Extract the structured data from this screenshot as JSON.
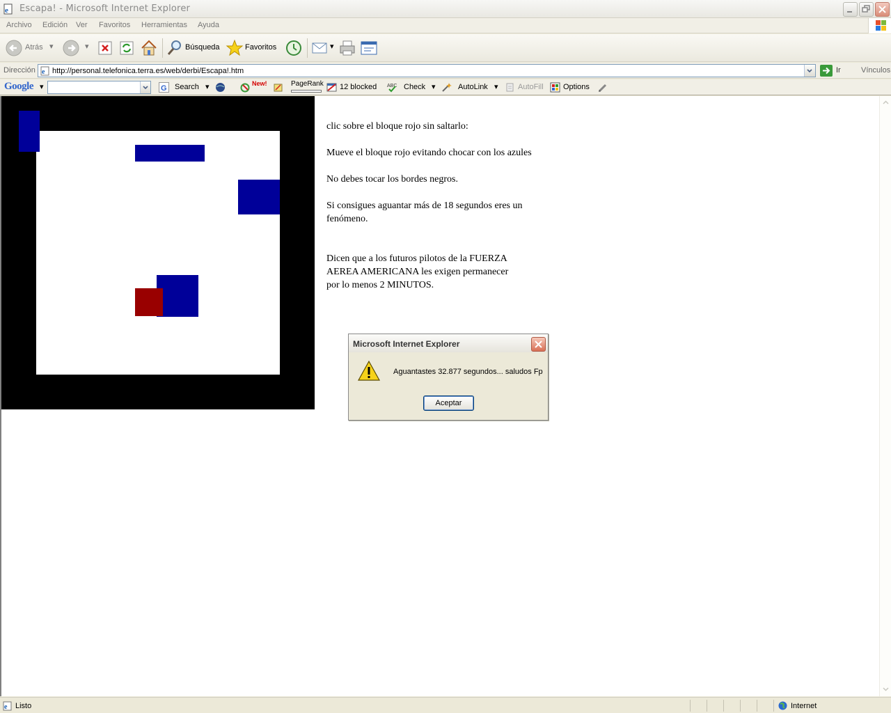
{
  "window": {
    "title": "Escapa! - Microsoft Internet Explorer"
  },
  "menu": {
    "items": [
      "Archivo",
      "Edición",
      "Ver",
      "Favoritos",
      "Herramientas",
      "Ayuda"
    ]
  },
  "toolbar": {
    "back_label": "Atrás",
    "search_label": "Búsqueda",
    "favorites_label": "Favoritos"
  },
  "address": {
    "label": "Dirección",
    "url": "http://personal.telefonica.terra.es/web/derbi/Escapa!.htm",
    "go_label": "Ir",
    "links_label": "Vínculos"
  },
  "google_toolbar": {
    "logo": "Google",
    "search_label": "Search",
    "new_badge": "New!",
    "pagerank_label": "PageRank",
    "blocked_label": "12 blocked",
    "check_label": "Check",
    "autolink_label": "AutoLink",
    "autofill_label": "AutoFill",
    "options_label": "Options"
  },
  "page": {
    "instructions": [
      "clic sobre el bloque rojo sin saltarlo:",
      "Mueve el bloque rojo evitando chocar con los azules",
      "No debes tocar los bordes negros.",
      "Si consigues aguantar más de 18 segundos eres un fenómeno.",
      "Dicen que a los futuros pilotos de la FUERZA AEREA AMERICANA les exigen permanecer por lo menos 2 MINUTOS."
    ]
  },
  "alert": {
    "title": "Microsoft Internet Explorer",
    "message": "Aguantastes 32.877 segundos... saludos Fp",
    "ok_label": "Aceptar"
  },
  "status": {
    "text": "Listo",
    "zone": "Internet"
  },
  "colors": {
    "board_border": "#000000",
    "blue_block": "#000099",
    "red_block": "#990000"
  }
}
